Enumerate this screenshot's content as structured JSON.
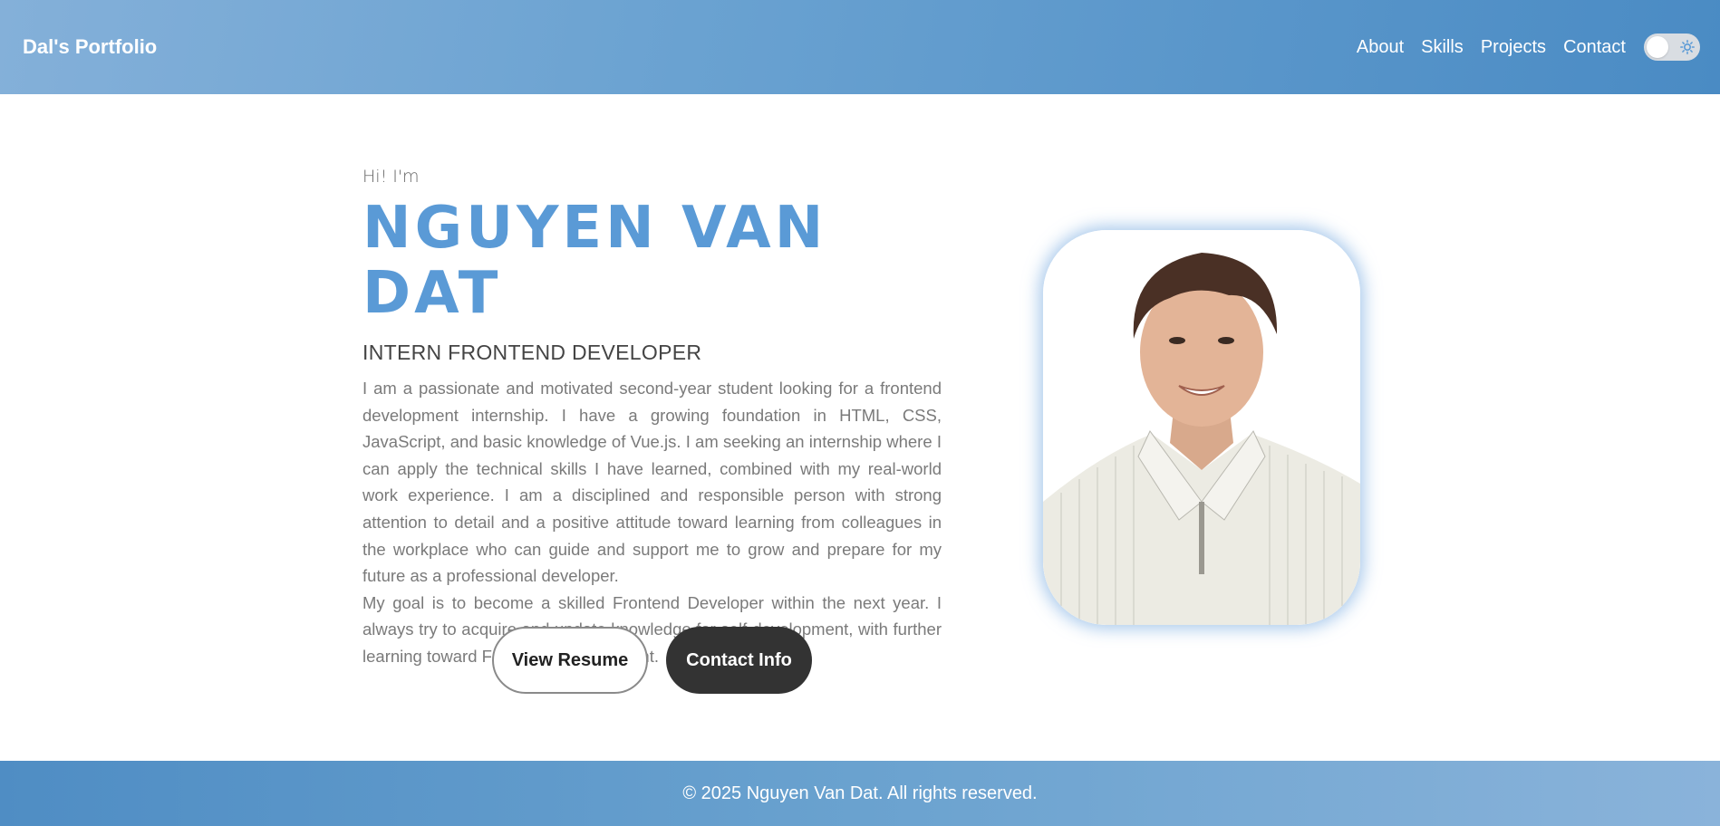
{
  "header": {
    "brand": "Dal's Portfolio",
    "nav": [
      "About",
      "Skills",
      "Projects",
      "Contact"
    ],
    "theme_toggle": {
      "state": "light",
      "icon": "sun-icon"
    }
  },
  "hero": {
    "greeting": "Hi! I'm",
    "name": "NGUYEN VAN DAT",
    "role": "INTERN FRONTEND DEVELOPER",
    "bio_p1": "I am a passionate and motivated second-year student looking for a frontend development internship. I have a growing foundation in HTML, CSS, JavaScript, and basic knowledge of Vue.js. I am seeking an internship where I can apply the technical skills I have learned, combined with my real-world work experience. I am a disciplined and responsible person with strong attention to detail and a positive attitude toward learning from colleagues in the workplace who can guide and support me to grow and prepare for my future as a professional developer.",
    "bio_p2": "My goal is to become a skilled Frontend Developer within the next year. I always try to acquire and update knowledge for self-development, with further learning toward Full-stack development.",
    "buttons": {
      "resume": "View Resume",
      "contact": "Contact Info"
    }
  },
  "colors": {
    "accent": "#5a9ad6",
    "header_start": "#84b0d9",
    "header_end": "#4a8bc4",
    "dark_button": "#333333"
  },
  "footer": {
    "text": "© 2025 Nguyen Van Dat. All rights reserved."
  }
}
